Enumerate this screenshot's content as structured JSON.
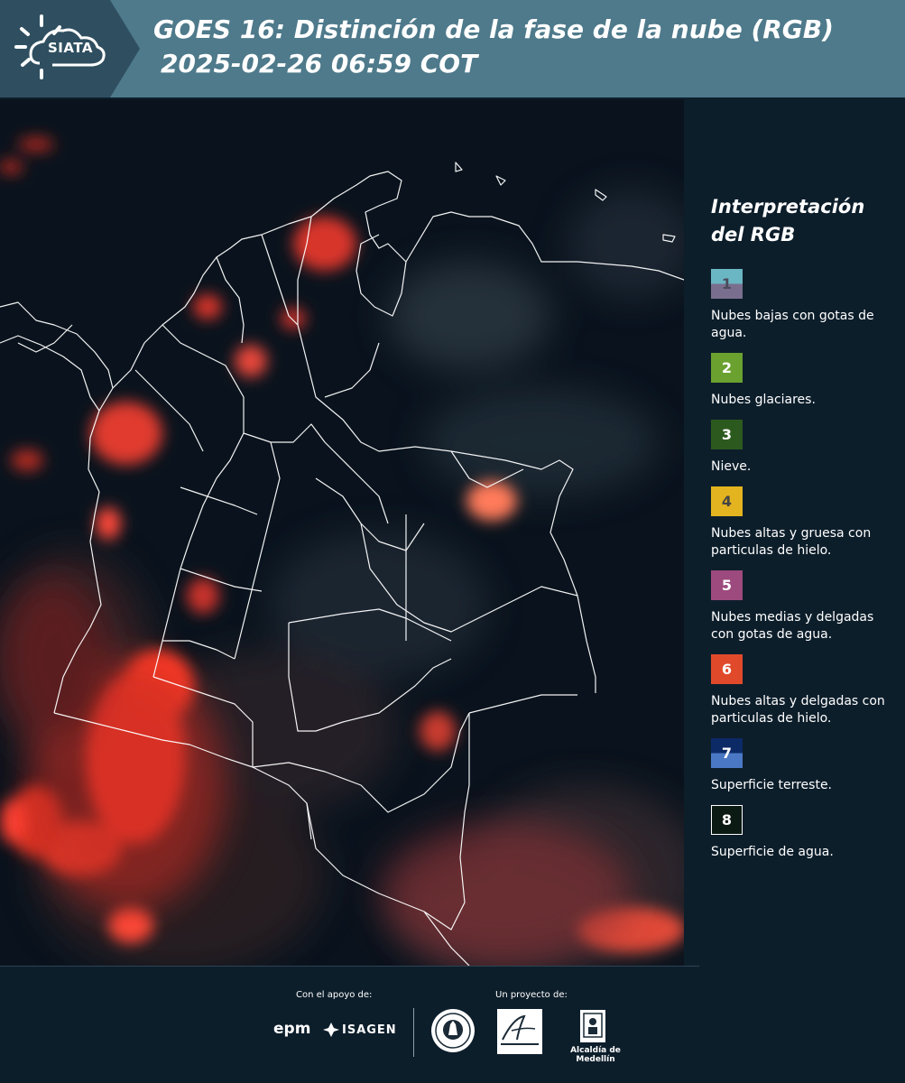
{
  "header": {
    "logo_text": "SIATA",
    "title_line1": "GOES 16: Distinción de la fase de la nube (RGB)",
    "title_line2": "2025-02-26 06:59 COT",
    "background": "#4e7a8b"
  },
  "legend": {
    "title_line1": "Interpretación",
    "title_line2": "del RGB",
    "items": [
      {
        "number": "1",
        "label": "Nubes bajas con gotas de agua.",
        "color_top": "#6bb6c3",
        "color_bottom": "#7a6e8e",
        "text_color": "#4a4a5a"
      },
      {
        "number": "2",
        "label": "Nubes glaciares.",
        "color_top": "#6aa12f",
        "color_bottom": "#6aa12f",
        "text_color": "#ffffff"
      },
      {
        "number": "3",
        "label": "Nieve.",
        "color_top": "#2c5a1e",
        "color_bottom": "#2c5a1e",
        "text_color": "#ffffff"
      },
      {
        "number": "4",
        "label": "Nubes altas y gruesa con particulas de hielo.",
        "color_top": "#e3b41f",
        "color_bottom": "#e3b41f",
        "text_color": "#444444"
      },
      {
        "number": "5",
        "label": "Nubes medias y delgadas con gotas de agua.",
        "color_top": "#9d4a7e",
        "color_bottom": "#9d4a7e",
        "text_color": "#ffffff"
      },
      {
        "number": "6",
        "label": "Nubes altas y delgadas con particulas de hielo.",
        "color_top": "#e04a2b",
        "color_bottom": "#e04a2b",
        "text_color": "#ffffff"
      },
      {
        "number": "7",
        "label": "Superficie terreste.",
        "color_top": "#0c2a66",
        "color_bottom": "#4a78c4",
        "text_color": "#ffffff"
      },
      {
        "number": "8",
        "label": "Superficie de agua.",
        "color_top": "#0b1a12",
        "color_bottom": "#0b1a12",
        "text_color": "#ffffff"
      }
    ]
  },
  "footer": {
    "support_label": "Con el apoyo de:",
    "project_label": "Un proyecto de:",
    "epm": "epm",
    "isagen": "ISAGEN",
    "alcaldia": "Alcaldía de Medellín"
  }
}
